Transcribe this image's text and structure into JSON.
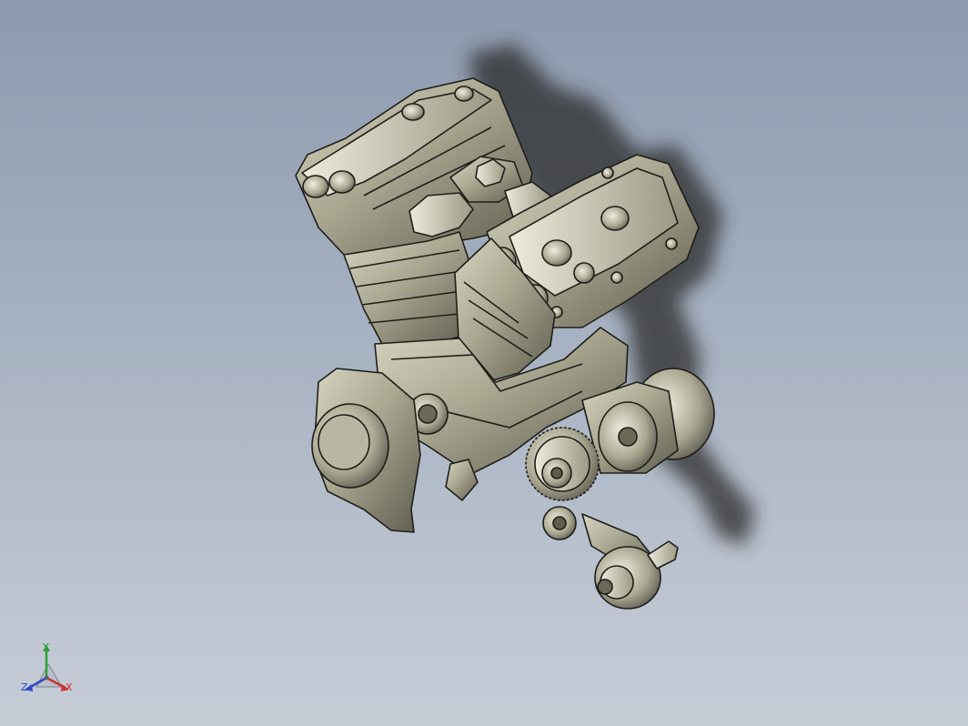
{
  "viewport": {
    "background_top": "#8d9aae",
    "background_bottom": "#c7cdd7",
    "model_color": "#a7a58f",
    "edge_color": "#1e1e1a",
    "shadow_color": "#2a2a2a"
  },
  "model": {
    "icon": "engine-assembly-icon"
  },
  "triad": {
    "x_label": "X",
    "y_label": "Y",
    "z_label": "Z",
    "x_color": "#cf2e2e",
    "y_color": "#2f9e3a",
    "z_color": "#2c49c4"
  }
}
